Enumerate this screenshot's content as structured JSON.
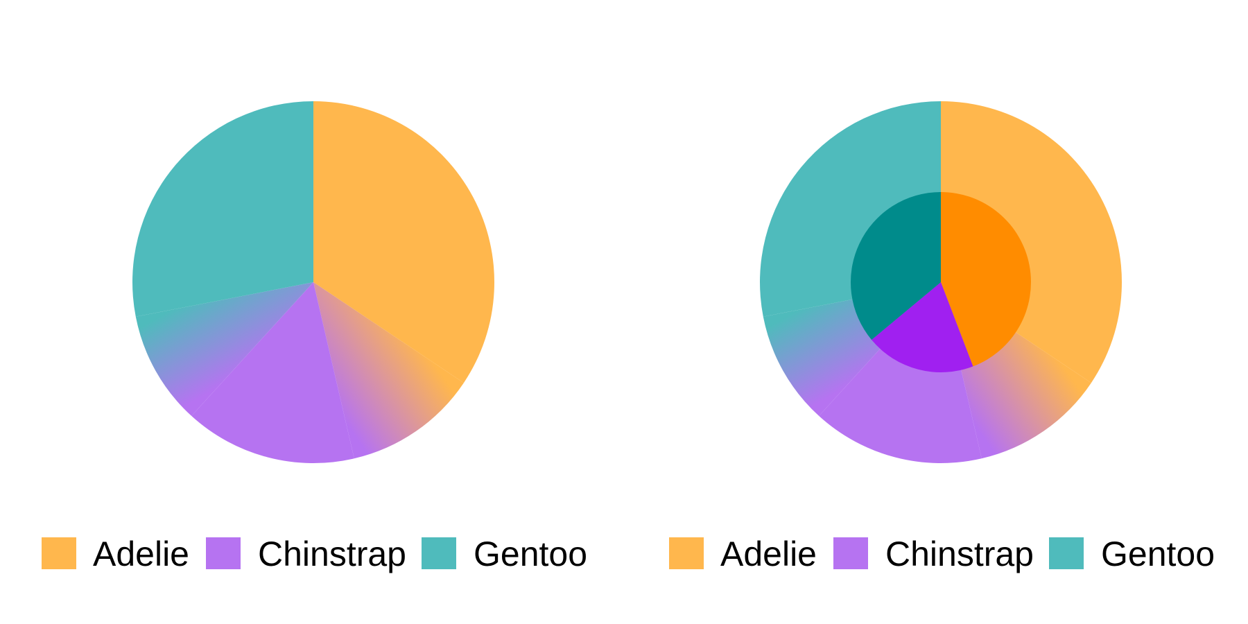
{
  "chart_data": [
    {
      "type": "pie",
      "legend_position": "bottom",
      "categories": [
        "Adelie",
        "Chinstrap",
        "Gentoo"
      ],
      "values": [
        152,
        68,
        124
      ],
      "colors": {
        "Adelie": "#FFB74D",
        "Chinstrap": "#B673F1",
        "Gentoo": "#4FBBBC"
      },
      "blended_sections": [
        {
          "from": "Adelie",
          "to": "Chinstrap",
          "value": 53
        },
        {
          "from": "Gentoo",
          "to": "Chinstrap",
          "value": 45
        }
      ],
      "legend": {
        "labels": [
          "Adelie",
          "Chinstrap",
          "Gentoo"
        ]
      }
    },
    {
      "type": "pie",
      "legend_position": "bottom",
      "outer_ring": {
        "categories": [
          "Adelie",
          "Chinstrap",
          "Gentoo"
        ],
        "values": [
          152,
          68,
          124
        ],
        "colors": {
          "Adelie": "#FFB74D",
          "Chinstrap": "#B673F1",
          "Gentoo": "#4FBBBC"
        },
        "blended_sections": [
          {
            "from": "Adelie",
            "to": "Chinstrap",
            "value": 53
          },
          {
            "from": "Gentoo",
            "to": "Chinstrap",
            "value": 45
          }
        ]
      },
      "inner_pie": {
        "categories": [
          "Adelie",
          "Chinstrap",
          "Gentoo"
        ],
        "values": [
          152,
          68,
          124
        ],
        "colors": {
          "Adelie": "#FF8C00",
          "Chinstrap": "#A020F0",
          "Gentoo": "#008B8B"
        }
      },
      "legend": {
        "labels": [
          "Adelie",
          "Chinstrap",
          "Gentoo"
        ]
      }
    }
  ]
}
